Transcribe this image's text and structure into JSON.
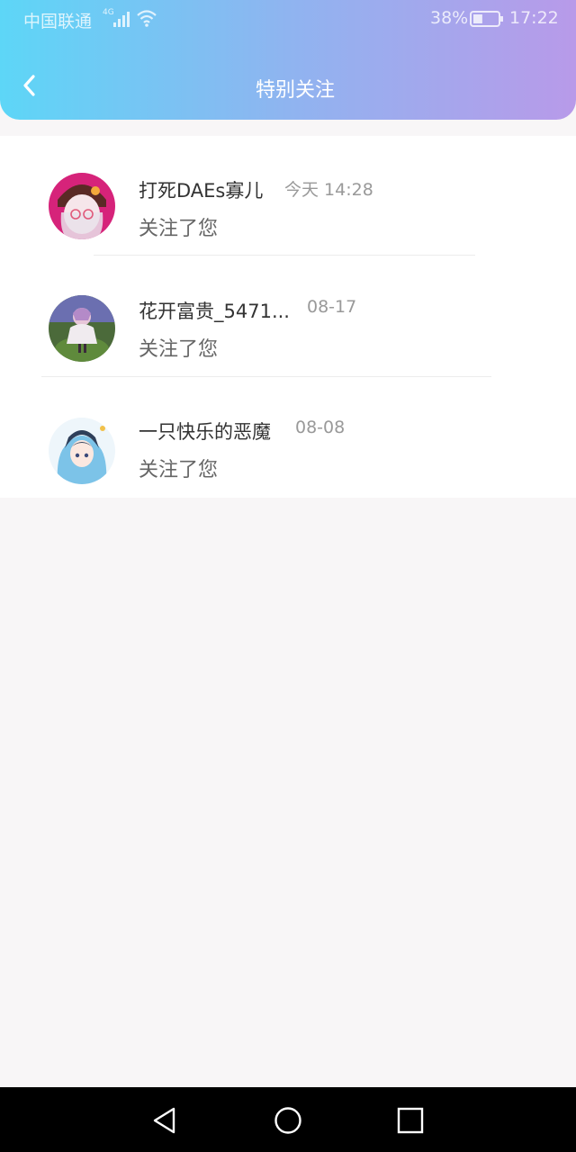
{
  "status_bar": {
    "carrier": "中国联通",
    "network": "4G",
    "battery_percent": "38%",
    "time": "17:22",
    "battery_level": 0.38
  },
  "header": {
    "title": "特别关注"
  },
  "items": [
    {
      "name": "打死DAEs寡儿",
      "time": "今天 14:28",
      "message": "关注了您"
    },
    {
      "name": "花开富贵_5471...",
      "time": "08-17",
      "message": "关注了您"
    },
    {
      "name": "一只快乐的恶魔",
      "time": "08-08",
      "message": "关注了您"
    }
  ],
  "colors": {
    "header_gradient_start": "#5dd6f7",
    "header_gradient_end": "#b89ae9",
    "background": "#f8f6f7"
  }
}
